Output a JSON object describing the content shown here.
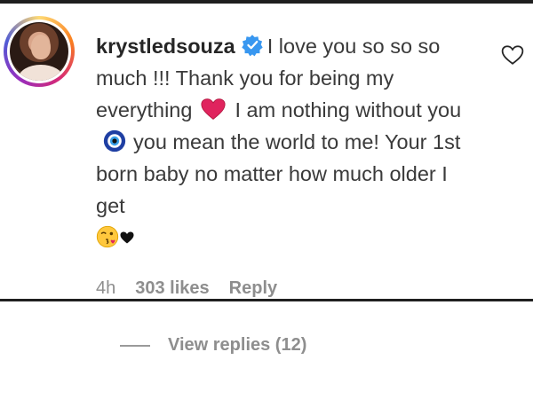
{
  "comment": {
    "username": "krystledsouza",
    "verified": true,
    "text_part1": "I love you so so so much !!! Thank you for being my everything",
    "text_part2": "I am nothing without you",
    "text_part3": "you mean the world to me! Your 1st born baby no matter how much older I get",
    "emojis": [
      "heart-emoji",
      "evil-eye-emoji",
      "wink-kiss-emoji",
      "black-heart-emoji"
    ],
    "timestamp": "4h",
    "likes": "303 likes",
    "reply_label": "Reply"
  },
  "replies": {
    "label": "View replies (12)"
  },
  "colors": {
    "text": "#262626",
    "meta": "#8e8e8e",
    "verified": "#3897f0",
    "heart": "#e0245e",
    "border": "#1f1f1f"
  }
}
